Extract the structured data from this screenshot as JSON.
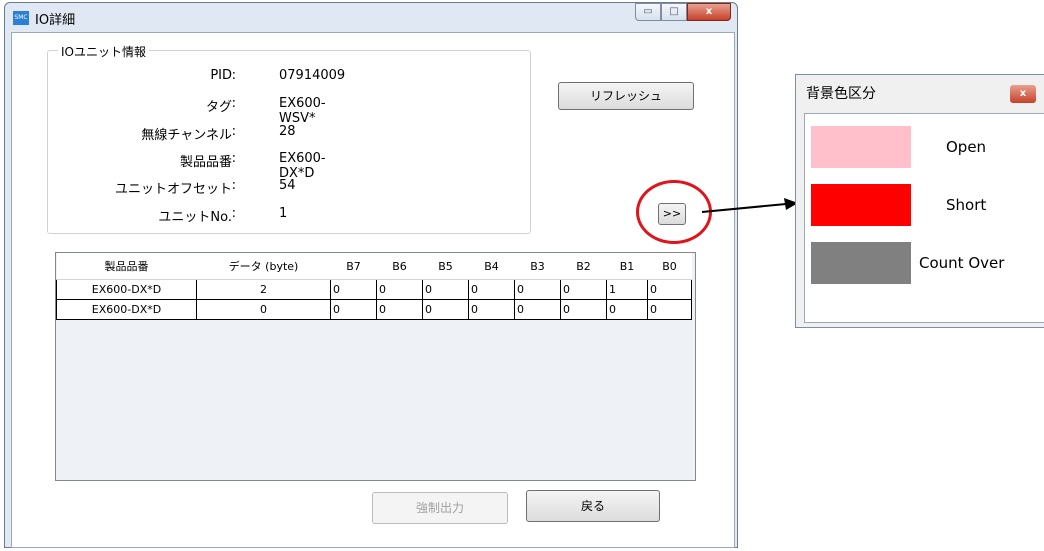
{
  "window": {
    "title": "IO詳細",
    "app_icon_text": "SMC",
    "minimize": "▭",
    "maximize": "□",
    "close": "x"
  },
  "unit_info": {
    "group_label": "IOユニット情報",
    "separator": ":",
    "fields": [
      {
        "label": "PID",
        "value": "07914009"
      },
      {
        "label": "タグ",
        "value": "EX600-WSV*"
      },
      {
        "label": "無線チャンネル",
        "value": "28"
      },
      {
        "label": "製品品番",
        "value": "EX600-DX*D"
      },
      {
        "label": "ユニットオフセット",
        "value": "54"
      },
      {
        "label": "ユニットNo.",
        "value": "1"
      }
    ]
  },
  "buttons": {
    "refresh": "リフレッシュ",
    "expand": ">>",
    "force_output": "強制出力",
    "back": "戻る"
  },
  "table": {
    "columns": [
      "製品品番",
      "データ (byte)",
      "B7",
      "B6",
      "B5",
      "B4",
      "B3",
      "B2",
      "B1",
      "B0"
    ],
    "rows": [
      [
        "EX600-DX*D",
        "2",
        "0",
        "0",
        "0",
        "0",
        "0",
        "0",
        "1",
        "0"
      ],
      [
        "EX600-DX*D",
        "0",
        "0",
        "0",
        "0",
        "0",
        "0",
        "0",
        "0",
        "0"
      ]
    ]
  },
  "legend": {
    "title": "背景色区分",
    "close": "x",
    "items": [
      {
        "label": "Open",
        "color": "#ffc0cb"
      },
      {
        "label": "Short",
        "color": "#ff0000"
      },
      {
        "label": "Count Over",
        "color": "#808080"
      }
    ]
  },
  "colors": {
    "highlight": "#e0141a"
  }
}
